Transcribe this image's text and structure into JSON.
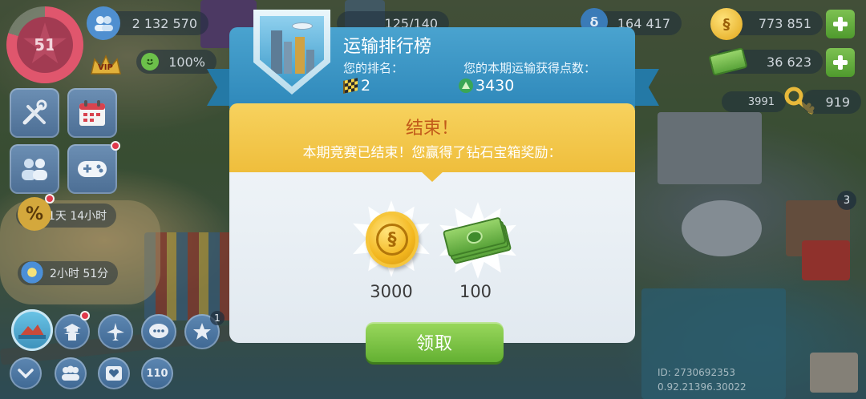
{
  "hud": {
    "level": "51",
    "population": "2 132 570",
    "happiness": "100%",
    "storage": "125/140",
    "currency_a": "164 417",
    "simoleons": "773 851",
    "simcash": "36 623",
    "golden_keys_count": "3991",
    "keys": "919",
    "vip_label": "VIP",
    "timer1": "1天 14小时",
    "timer2": "2小时 51分",
    "bottom_badge_count": "1",
    "side_badge_count": "3",
    "bottom_icon_label": "110",
    "id_line": "ID: 2730692353",
    "version_line": "0.92.21396.30022"
  },
  "modal": {
    "title": "运输排行榜",
    "rank_label": "您的排名：",
    "rank_value": "2",
    "points_label": "您的本期运输获得点数：",
    "points_value": "3430",
    "end_title": "结束！",
    "end_message": "本期竞赛已结束！您赢得了钻石宝箱奖励：",
    "rewards": [
      {
        "icon": "simoleon-coin-icon",
        "value": "3000"
      },
      {
        "icon": "simcash-bills-icon",
        "value": "100"
      }
    ],
    "claim_label": "领取"
  },
  "colors": {
    "header_blue": "#3a97c5",
    "banner_gold": "#f2c447",
    "claim_green": "#7cc447",
    "end_title_orange": "#c25a1a"
  }
}
